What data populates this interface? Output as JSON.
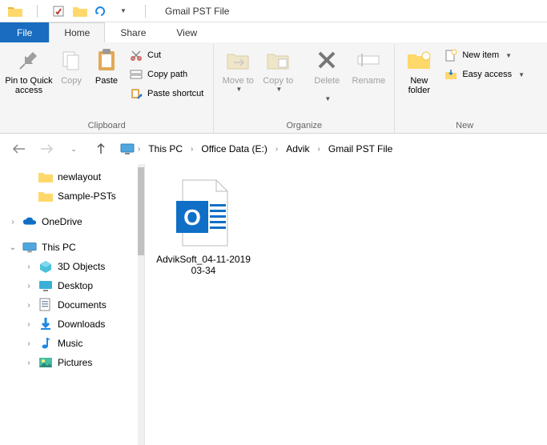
{
  "title": "Gmail PST File",
  "tabs": {
    "file": "File",
    "home": "Home",
    "share": "Share",
    "view": "View"
  },
  "ribbon": {
    "pin": "Pin to Quick access",
    "copy": "Copy",
    "paste": "Paste",
    "cut": "Cut",
    "copypath": "Copy path",
    "pasteshortcut": "Paste shortcut",
    "clipboard_label": "Clipboard",
    "move": "Move to",
    "copyto": "Copy to",
    "delete": "Delete",
    "rename": "Rename",
    "organize_label": "Organize",
    "newfolder": "New folder",
    "newitem": "New item",
    "easyaccess": "Easy access",
    "new_label": "New"
  },
  "breadcrumb": [
    "This PC",
    "Office Data (E:)",
    "Advik",
    "Gmail PST File"
  ],
  "tree": [
    {
      "label": "newlayout",
      "icon": "folder",
      "indent": 1
    },
    {
      "label": "Sample-PSTs",
      "icon": "folder",
      "indent": 1
    },
    {
      "spacer": true
    },
    {
      "label": "OneDrive",
      "icon": "onedrive",
      "indent": 0,
      "exp": ">"
    },
    {
      "spacer": true
    },
    {
      "label": "This PC",
      "icon": "thispc",
      "indent": 0,
      "exp": "v"
    },
    {
      "label": "3D Objects",
      "icon": "3d",
      "indent": 2,
      "exp": ">"
    },
    {
      "label": "Desktop",
      "icon": "desktop",
      "indent": 2,
      "exp": ">"
    },
    {
      "label": "Documents",
      "icon": "documents",
      "indent": 2,
      "exp": ">"
    },
    {
      "label": "Downloads",
      "icon": "downloads",
      "indent": 2,
      "exp": ">"
    },
    {
      "label": "Music",
      "icon": "music",
      "indent": 2,
      "exp": ">"
    },
    {
      "label": "Pictures",
      "icon": "pictures",
      "indent": 2,
      "exp": ">"
    }
  ],
  "files": [
    {
      "name": "AdvikSoft_04-11-2019 03-34"
    }
  ]
}
